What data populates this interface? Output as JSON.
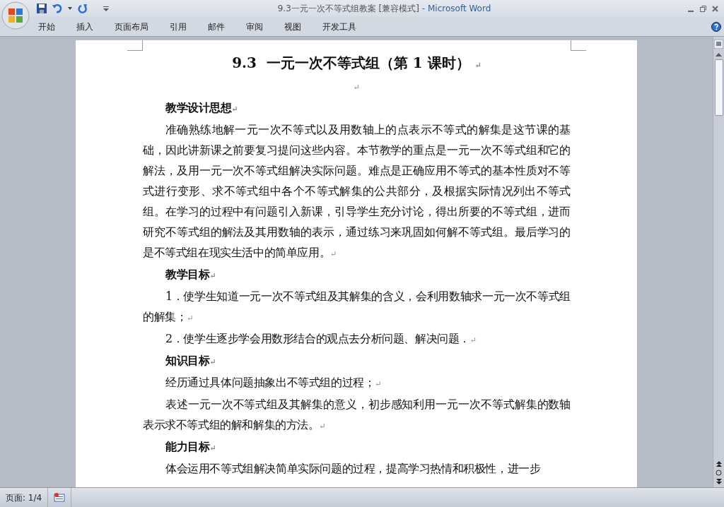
{
  "window": {
    "title": "9.3一元一次不等式组教案 [兼容模式]",
    "separator": "-",
    "app": "Microsoft Word"
  },
  "ribbon_tabs": [
    {
      "label": "开始"
    },
    {
      "label": "插入"
    },
    {
      "label": "页面布局"
    },
    {
      "label": "引用"
    },
    {
      "label": "邮件"
    },
    {
      "label": "审阅"
    },
    {
      "label": "视图"
    },
    {
      "label": "开发工具"
    }
  ],
  "document": {
    "title": "9.3  一元一次不等式组（第 1 课时）",
    "title_mark": "↵",
    "blocks": [
      {
        "kind": "blank",
        "mark": "↵"
      },
      {
        "kind": "heading",
        "text": "教学设计思想",
        "mark": "↵"
      },
      {
        "kind": "para",
        "text": "准确熟练地解一元一次不等式以及用数轴上的点表示不等式的解集是这节课的基础，因此讲新课之前要复习提问这些内容。本节教学的重点是一元一次不等式组和它的解法，及用一元一次不等式组解决实际问题。难点是正确应用不等式的基本性质对不等式进行变形、求不等式组中各个不等式解集的公共部分，及根据实际情况列出不等式组。在学习的过程中有问题引入新课，引导学生充分讨论，得出所要的不等式组，进而研究不等式组的解法及其用数轴的表示，通过练习来巩固如何解不等式组。最后学习的是不等式组在现实生活中的简单应用。",
        "mark": "↵"
      },
      {
        "kind": "heading",
        "text": "教学目标",
        "mark": "↵"
      },
      {
        "kind": "para",
        "text": "1．使学生知道一元一次不等式组及其解集的含义，会利用数轴求一元一次不等式组的解集；",
        "mark": "↵"
      },
      {
        "kind": "para",
        "text": "2．使学生逐步学会用数形结合的观点去分析问题、解决问题．",
        "mark": "↵"
      },
      {
        "kind": "heading",
        "text": "知识目标",
        "mark": "↵"
      },
      {
        "kind": "para",
        "text": "经历通过具体问题抽象出不等式组的过程；",
        "mark": "↵"
      },
      {
        "kind": "para",
        "text": "表述一元一次不等式组及其解集的意义，初步感知利用一元一次不等式解集的数轴表示求不等式组的解和解集的方法。",
        "mark": "↵"
      },
      {
        "kind": "heading",
        "text": "能力目标",
        "mark": "↵"
      },
      {
        "kind": "para",
        "text": "体会运用不等式组解决简单实际问题的过程，提高学习热情和积极性，进一步"
      }
    ]
  },
  "status_bar": {
    "page": "页面: 1/4"
  }
}
